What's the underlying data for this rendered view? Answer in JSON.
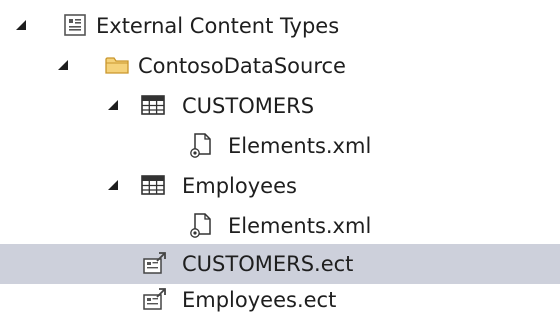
{
  "tree": {
    "nodes": [
      {
        "label": "External Content Types",
        "icon": "external-content-types-icon",
        "expanded": true
      },
      {
        "label": "ContosoDataSource",
        "icon": "folder-icon",
        "expanded": true
      },
      {
        "label": "CUSTOMERS",
        "icon": "table-icon",
        "expanded": true
      },
      {
        "label": "Elements.xml",
        "icon": "xml-file-icon"
      },
      {
        "label": "Employees",
        "icon": "table-icon",
        "expanded": true
      },
      {
        "label": "Elements.xml",
        "icon": "xml-file-icon"
      },
      {
        "label": "CUSTOMERS.ect",
        "icon": "ect-file-icon",
        "selected": true
      },
      {
        "label": "Employees.ect",
        "icon": "ect-file-icon"
      }
    ]
  },
  "colors": {
    "selection": "#cdd0db",
    "folder": "#e8b84a",
    "text": "#1e1e1e"
  }
}
